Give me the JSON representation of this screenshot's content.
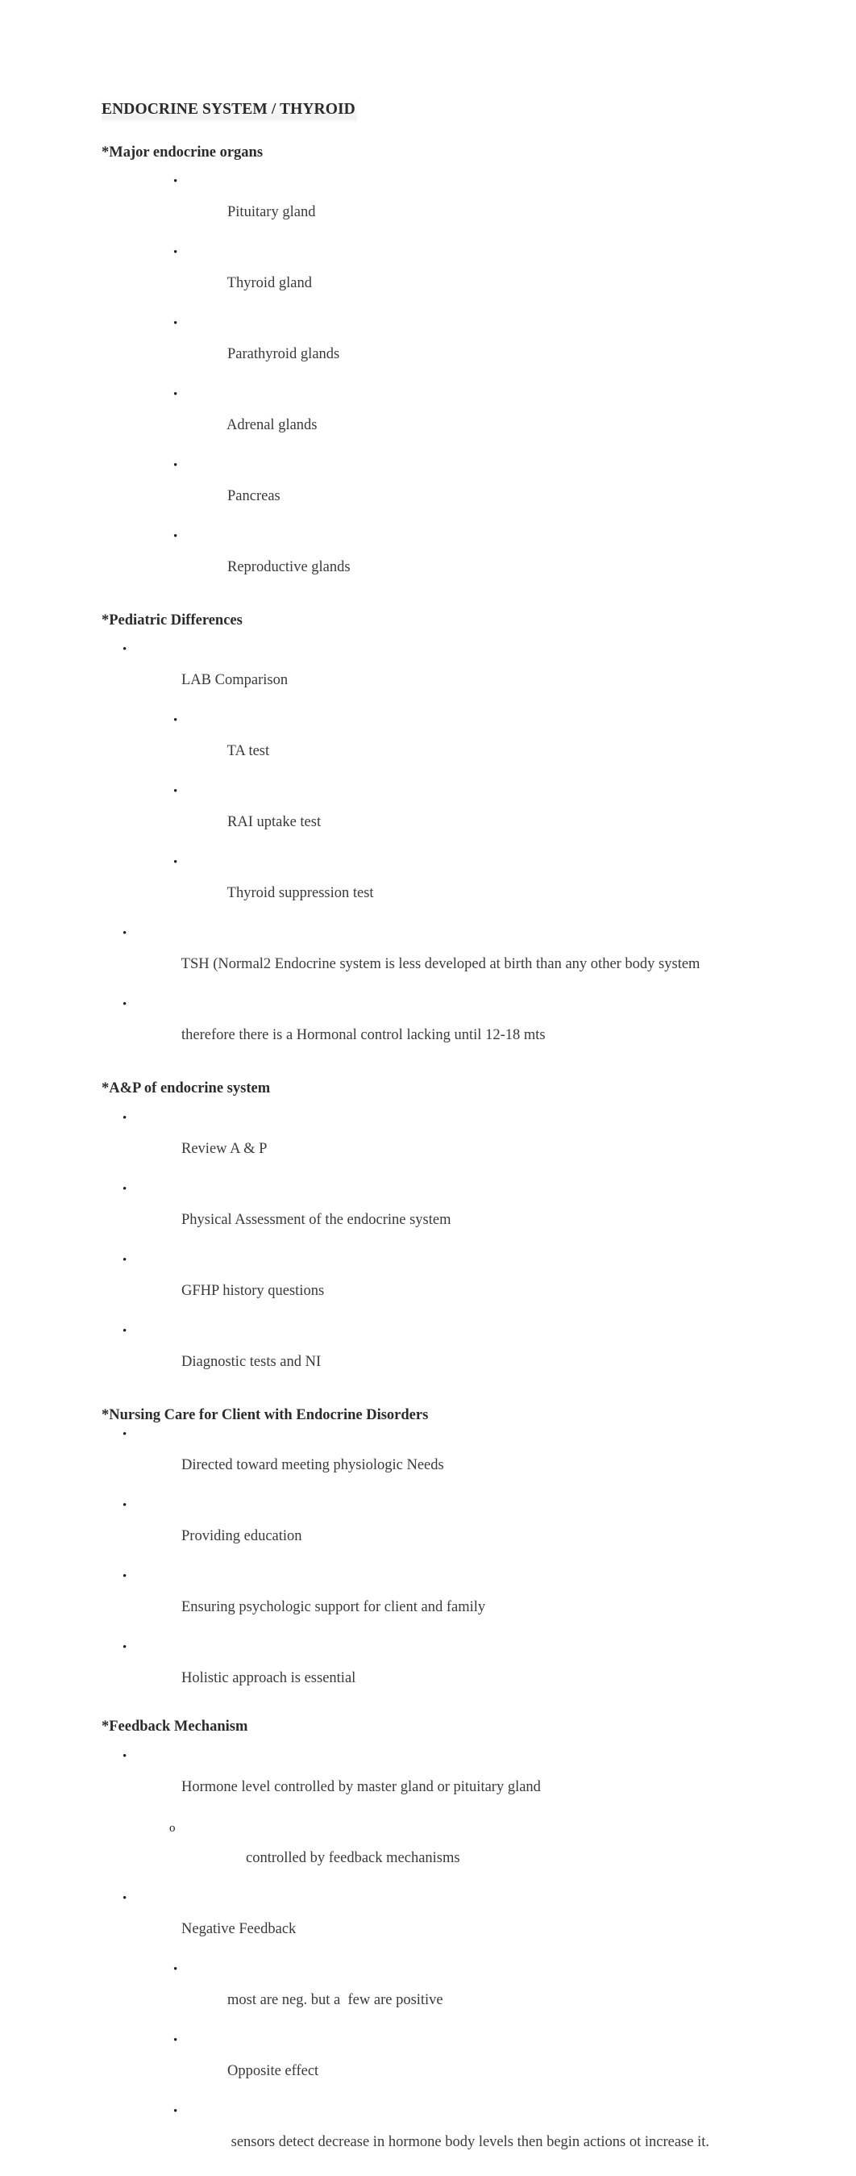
{
  "document": {
    "title": "ENDOCRINE SYSTEM / THYROID",
    "text_color": "#3a3a3a",
    "heading_color": "#2b2b2b",
    "background_color": "#ffffff",
    "bullet_glyph": "•",
    "hollow_bullet_glyph": "o"
  },
  "sections": [
    {
      "heading": "*Major endocrine organs",
      "items": [
        {
          "text": "Pituitary gland"
        },
        {
          "text": "Thyroid gland"
        },
        {
          "text": "Parathyroid glands"
        },
        {
          "text": "Adrenal glands"
        },
        {
          "text": "Pancreas"
        },
        {
          "text": "Reproductive glands"
        }
      ]
    },
    {
      "heading": "*Pediatric Differences",
      "items": [
        {
          "text": "LAB Comparison"
        },
        {
          "text": "TA test"
        },
        {
          "text": "RAI uptake test"
        },
        {
          "text": "Thyroid suppression test"
        },
        {
          "text": "TSH (Normal2 Endocrine system is less developed at birth than any other body system"
        },
        {
          "text": "therefore there is a Hormonal control lacking until 12-18 mts"
        }
      ]
    },
    {
      "heading": "*A&P of endocrine system",
      "items": [
        {
          "text": "Review A & P"
        },
        {
          "text": "Physical Assessment of the endocrine system"
        },
        {
          "text": "GFHP history questions"
        },
        {
          "text": "Diagnostic tests and NI"
        }
      ]
    },
    {
      "heading": "*Nursing Care for Client with Endocrine Disorders",
      "items": [
        {
          "text": "Directed toward meeting physiologic Needs"
        },
        {
          "text": "Providing education"
        },
        {
          "text": "Ensuring psychologic support for client and family"
        },
        {
          "text": "Holistic approach is essential"
        }
      ]
    },
    {
      "heading": "*Feedback Mechanism",
      "items": [
        {
          "text": "Hormone level controlled by master gland or pituitary gland"
        },
        {
          "text": "controlled by feedback mechanisms"
        },
        {
          "text": "Negative Feedback"
        },
        {
          "text": "most are neg. but a  few are positive"
        },
        {
          "text": "Opposite effect"
        },
        {
          "text": " sensors detect decrease in hormone body levels then begin actions ot increase it."
        }
      ]
    }
  ]
}
